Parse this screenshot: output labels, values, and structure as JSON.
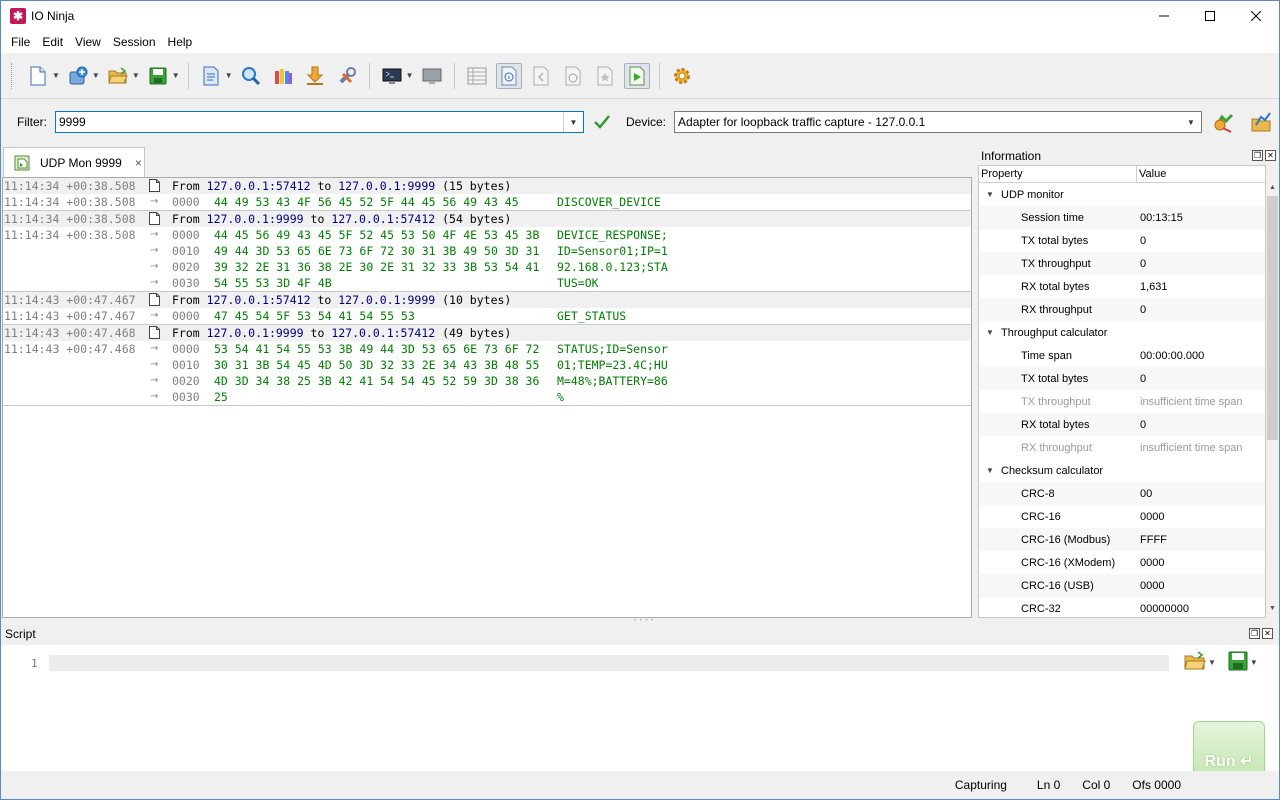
{
  "window": {
    "title": "IO Ninja"
  },
  "menu": [
    "File",
    "Edit",
    "View",
    "Session",
    "Help"
  ],
  "toolbar": {
    "icons": [
      "new-session-icon",
      "plugin-icon",
      "open-icon",
      "save-icon",
      "log-file-icon",
      "find-icon",
      "colors-icon",
      "download-icon",
      "wrench-icon",
      "terminal-icon",
      "terminal-gray-icon",
      "table-icon",
      "info-icon",
      "back-icon",
      "stopwatch-icon",
      "star-icon",
      "play-icon",
      "gear-icon"
    ]
  },
  "filter": {
    "label": "Filter:",
    "value": "9999"
  },
  "device": {
    "label": "Device:",
    "value": "Adapter for loopback traffic capture - 127.0.0.1"
  },
  "tab": {
    "label": "UDP Mon 9999",
    "close": "×"
  },
  "log": [
    {
      "kind": "hdr",
      "ts": "11:14:34 +00:38.508",
      "from_word": "From",
      "src": "127.0.0.1:57412",
      "to_word": "to",
      "dst": "127.0.0.1:9999",
      "size": "(15 bytes)"
    },
    {
      "kind": "data",
      "ts": "11:14:34 +00:38.508",
      "arrow": "→",
      "offset": "0000",
      "hex": "44 49 53 43 4F 56 45 52 5F 44 45 56 49 43 45",
      "ascii": "DISCOVER_DEVICE"
    },
    {
      "kind": "hdr",
      "ts": "11:14:34 +00:38.508",
      "from_word": "From",
      "src": "127.0.0.1:9999",
      "to_word": "to",
      "dst": "127.0.0.1:57412",
      "size": "(54 bytes)"
    },
    {
      "kind": "data",
      "ts": "11:14:34 +00:38.508",
      "arrow": "→",
      "offset": "0000",
      "hex": "44 45 56 49 43 45 5F 52 45 53 50 4F 4E 53 45 3B",
      "ascii": "DEVICE_RESPONSE;"
    },
    {
      "kind": "data",
      "ts": "",
      "arrow": "→",
      "offset": "0010",
      "hex": "49 44 3D 53 65 6E 73 6F 72 30 31 3B 49 50 3D 31",
      "ascii": "ID=Sensor01;IP=1"
    },
    {
      "kind": "data",
      "ts": "",
      "arrow": "→",
      "offset": "0020",
      "hex": "39 32 2E 31 36 38 2E 30 2E 31 32 33 3B 53 54 41",
      "ascii": "92.168.0.123;STA"
    },
    {
      "kind": "data",
      "ts": "",
      "arrow": "→",
      "offset": "0030",
      "hex": "54 55 53 3D 4F 4B",
      "ascii": "TUS=OK"
    },
    {
      "kind": "hdr",
      "ts": "11:14:43 +00:47.467",
      "from_word": "From",
      "src": "127.0.0.1:57412",
      "to_word": "to",
      "dst": "127.0.0.1:9999",
      "size": "(10 bytes)"
    },
    {
      "kind": "data",
      "ts": "11:14:43 +00:47.467",
      "arrow": "→",
      "offset": "0000",
      "hex": "47 45 54 5F 53 54 41 54 55 53",
      "ascii": "GET_STATUS"
    },
    {
      "kind": "hdr",
      "ts": "11:14:43 +00:47.468",
      "from_word": "From",
      "src": "127.0.0.1:9999",
      "to_word": "to",
      "dst": "127.0.0.1:57412",
      "size": "(49 bytes)"
    },
    {
      "kind": "data",
      "ts": "11:14:43 +00:47.468",
      "arrow": "→",
      "offset": "0000",
      "hex": "53 54 41 54 55 53 3B 49 44 3D 53 65 6E 73 6F 72",
      "ascii": "STATUS;ID=Sensor"
    },
    {
      "kind": "data",
      "ts": "",
      "arrow": "→",
      "offset": "0010",
      "hex": "30 31 3B 54 45 4D 50 3D 32 33 2E 34 43 3B 48 55",
      "ascii": "01;TEMP=23.4C;HU"
    },
    {
      "kind": "data",
      "ts": "",
      "arrow": "→",
      "offset": "0020",
      "hex": "4D 3D 34 38 25 3B 42 41 54 54 45 52 59 3D 38 36",
      "ascii": "M=48%;BATTERY=86"
    },
    {
      "kind": "data",
      "ts": "",
      "arrow": "→",
      "offset": "0030",
      "hex": "25",
      "ascii": "%"
    }
  ],
  "info": {
    "title": "Information",
    "col_property": "Property",
    "col_value": "Value",
    "groups": [
      {
        "name": "UDP monitor",
        "rows": [
          {
            "name": "Session time",
            "value": "00:13:15",
            "disabled": false
          },
          {
            "name": "TX total bytes",
            "value": "0",
            "disabled": false
          },
          {
            "name": "TX throughput",
            "value": "0",
            "disabled": false
          },
          {
            "name": "RX total bytes",
            "value": "1,631",
            "disabled": false
          },
          {
            "name": "RX throughput",
            "value": "0",
            "disabled": false
          }
        ]
      },
      {
        "name": "Throughput calculator",
        "rows": [
          {
            "name": "Time span",
            "value": "00:00:00.000",
            "disabled": false
          },
          {
            "name": "TX total bytes",
            "value": "0",
            "disabled": false
          },
          {
            "name": "TX throughput",
            "value": "insufficient time span",
            "disabled": true
          },
          {
            "name": "RX total bytes",
            "value": "0",
            "disabled": false
          },
          {
            "name": "RX throughput",
            "value": "insufficient time span",
            "disabled": true
          }
        ]
      },
      {
        "name": "Checksum calculator",
        "rows": [
          {
            "name": "CRC-8",
            "value": "00",
            "disabled": false
          },
          {
            "name": "CRC-16",
            "value": "0000",
            "disabled": false
          },
          {
            "name": "CRC-16 (Modbus)",
            "value": "FFFF",
            "disabled": false
          },
          {
            "name": "CRC-16 (XModem)",
            "value": "0000",
            "disabled": false
          },
          {
            "name": "CRC-16 (USB)",
            "value": "0000",
            "disabled": false
          },
          {
            "name": "CRC-32",
            "value": "00000000",
            "disabled": false
          }
        ]
      }
    ]
  },
  "script": {
    "title": "Script",
    "line_number": "1",
    "run_label": "Run ↵"
  },
  "status": {
    "state": "Capturing",
    "line": "Ln 0",
    "col": "Col 0",
    "ofs": "Ofs 0000"
  }
}
